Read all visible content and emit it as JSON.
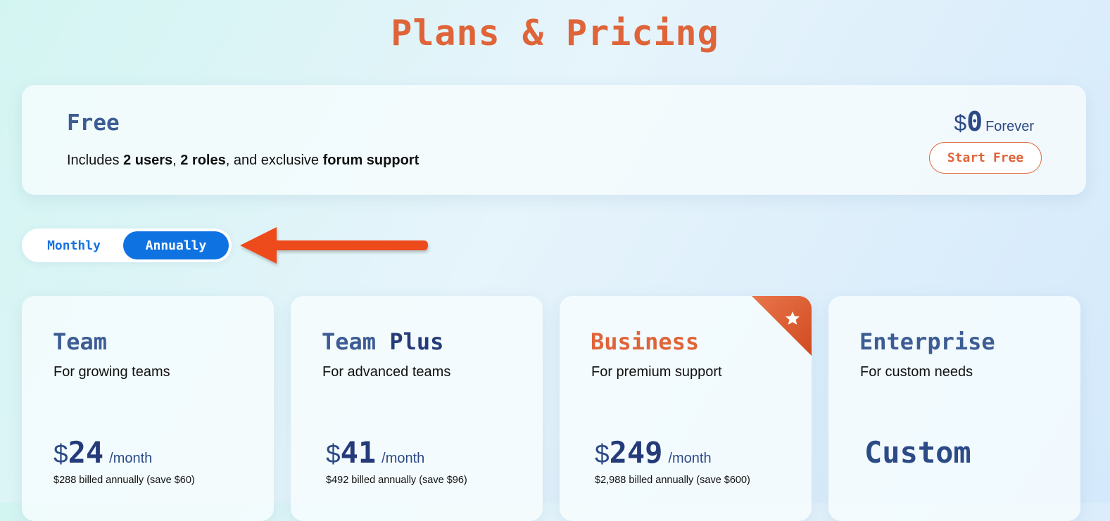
{
  "header": {
    "title": "Plans & Pricing"
  },
  "free_plan": {
    "name": "Free",
    "desc_parts": [
      "Includes ",
      "2 users",
      ", ",
      "2 roles",
      ", and exclusive ",
      "forum support"
    ],
    "currency": "$",
    "price": "0",
    "period": "Forever",
    "cta": "Start Free"
  },
  "billing_toggle": {
    "monthly": "Monthly",
    "annually": "Annually",
    "selected": "Annually"
  },
  "plans": [
    {
      "name": "Team",
      "tagline": "For growing teams",
      "currency": "$",
      "price": "24",
      "per": "/month",
      "billing": "$288 billed annually (save $60)"
    },
    {
      "name_a": "Team",
      "name_b": "Plus",
      "tagline": "For advanced teams",
      "currency": "$",
      "price": "41",
      "per": "/month",
      "billing": "$492 billed annually (save $96)"
    },
    {
      "name": "Business",
      "tagline": "For premium support",
      "currency": "$",
      "price": "249",
      "per": "/month",
      "billing": "$2,988 billed annually (save $600)",
      "badge_icon": "star-icon"
    },
    {
      "name": "Enterprise",
      "tagline": "For custom needs",
      "price": "Custom"
    }
  ],
  "colors": {
    "accent_orange": "#df6439",
    "toggle_blue": "#0f72e1",
    "title_navy": "#253b79"
  }
}
